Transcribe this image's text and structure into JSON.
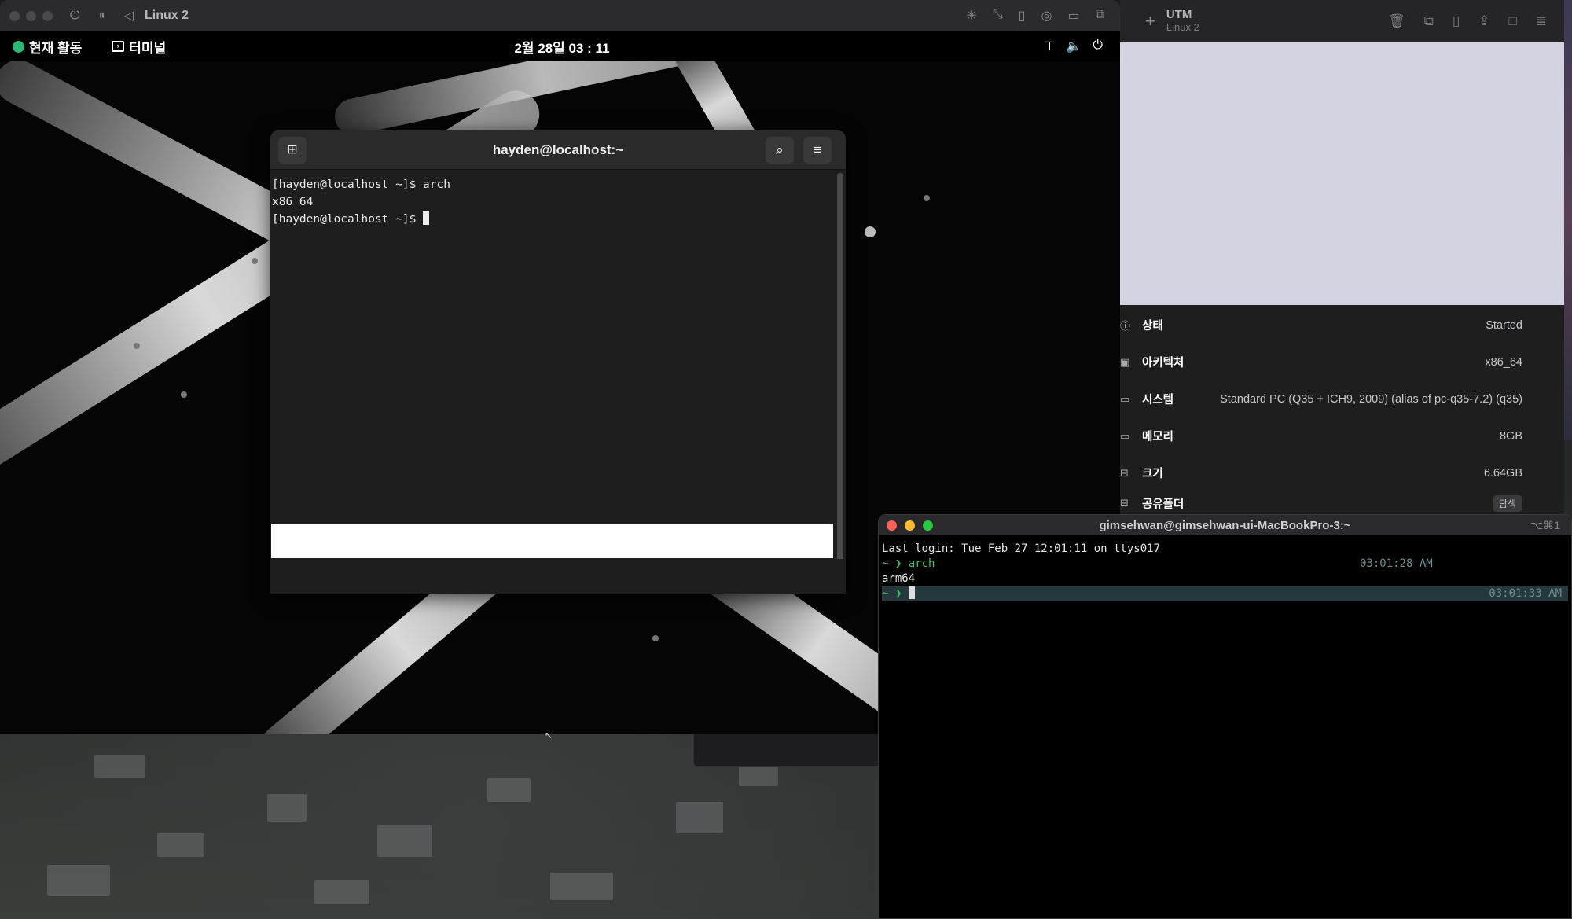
{
  "utm_window": {
    "title": "Linux 2",
    "controls": {
      "power": "⏻",
      "pause": "⏸",
      "back": "◁"
    },
    "toolbar_icons": [
      "display-icon",
      "resize-icon",
      "usb-icon",
      "disk-icon",
      "folder-icon",
      "windows-icon"
    ]
  },
  "gnome_bar": {
    "activities": "현재 활동",
    "app_name": "터미널",
    "clock": "2월 28일 03 : 11"
  },
  "gnome_terminal": {
    "title": "hayden@localhost:~",
    "lines": [
      "[hayden@localhost ~]$ arch",
      "x86_64",
      "[hayden@localhost ~]$ "
    ]
  },
  "utm_panel": {
    "app_title": "UTM",
    "vm_subtitle": "Linux 2",
    "rows": [
      {
        "label": "상태",
        "value": "Started",
        "icon": "info-icon"
      },
      {
        "label": "아키텍처",
        "value": "x86_64",
        "icon": "cpu-icon"
      },
      {
        "label": "시스템",
        "value": "Standard PC (Q35 + ICH9, 2009) (alias of pc-q35-7.2) (q35)",
        "icon": "display-icon"
      },
      {
        "label": "메모리",
        "value": "8GB",
        "icon": "memory-icon"
      },
      {
        "label": "크기",
        "value": "6.64GB",
        "icon": "drive-icon"
      },
      {
        "label": "공유폴더",
        "value": "탐색",
        "icon": "shared-folder-icon"
      }
    ]
  },
  "mac_terminal": {
    "title": "gimsehwan@gimsehwan-ui-MacBookPro-3:~",
    "shortcut": "⌥⌘1",
    "last_login": "Last login: Tue Feb 27 12:01:11 on ttys017",
    "prompt": "~ ❯",
    "cmd1": "arch",
    "time1": "03:01:28 AM",
    "output1": "arm64",
    "time2": "03:01:33 AM"
  }
}
